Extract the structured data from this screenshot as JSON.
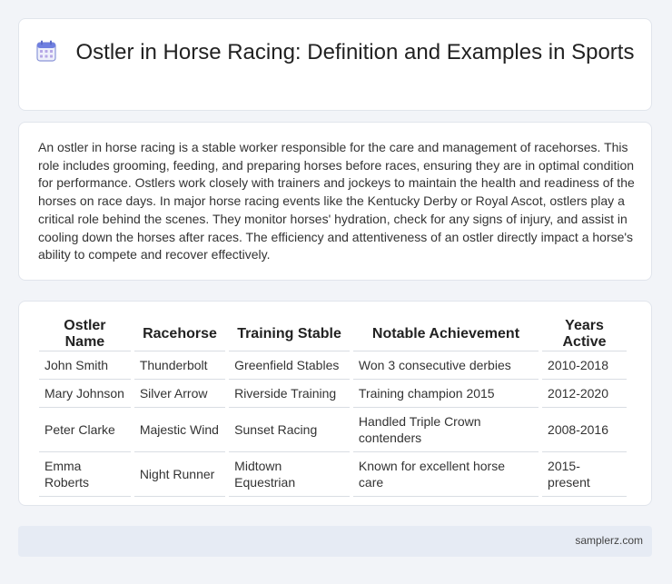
{
  "header": {
    "title": "Ostler in Horse Racing: Definition and Examples in Sports",
    "icon": "calendar-icon"
  },
  "intro": {
    "text": "An ostler in horse racing is a stable worker responsible for the care and management of racehorses. This role includes grooming, feeding, and preparing horses before races, ensuring they are in optimal condition for performance. Ostlers work closely with trainers and jockeys to maintain the health and readiness of the horses on race days. In major horse racing events like the Kentucky Derby or Royal Ascot, ostlers play a critical role behind the scenes. They monitor horses' hydration, check for any signs of injury, and assist in cooling down the horses after races. The efficiency and attentiveness of an ostler directly impact a horse's ability to compete and recover effectively."
  },
  "table": {
    "headers": [
      "Ostler Name",
      "Racehorse",
      "Training Stable",
      "Notable Achievement",
      "Years Active"
    ],
    "rows": [
      [
        "John Smith",
        "Thunderbolt",
        "Greenfield Stables",
        "Won 3 consecutive derbies",
        "2010-2018"
      ],
      [
        "Mary Johnson",
        "Silver Arrow",
        "Riverside Training",
        "Training champion 2015",
        "2012-2020"
      ],
      [
        "Peter Clarke",
        "Majestic Wind",
        "Sunset Racing",
        "Handled Triple Crown contenders",
        "2008-2016"
      ],
      [
        "Emma Roberts",
        "Night Runner",
        "Midtown Equestrian",
        "Known for excellent horse care",
        "2015-present"
      ]
    ]
  },
  "footer": {
    "site": "samplerz.com"
  }
}
